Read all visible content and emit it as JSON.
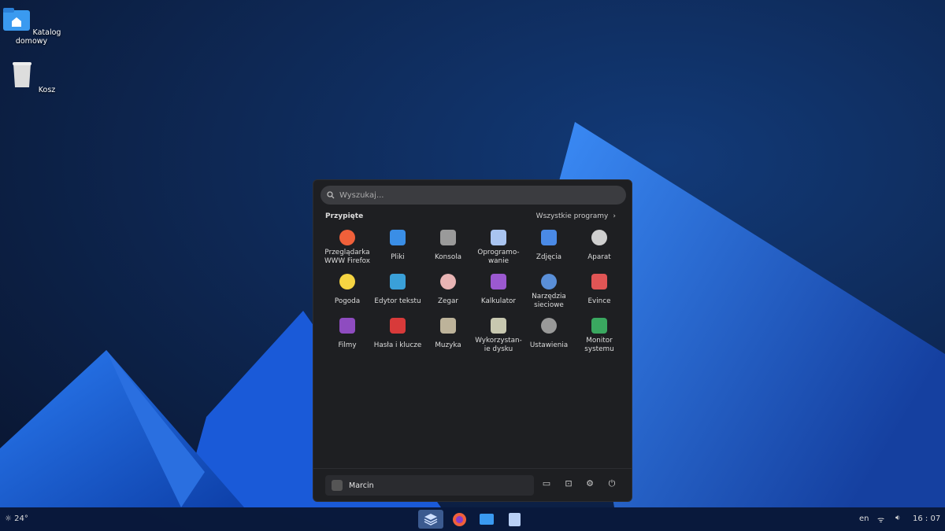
{
  "desktop": {
    "icons": [
      {
        "label": "Katalog domowy",
        "icon": "folder-home-icon"
      },
      {
        "label": "Kosz",
        "icon": "trash-icon"
      }
    ]
  },
  "menu": {
    "search_placeholder": "Wyszukaj...",
    "pinned_label": "Przypięte",
    "all_programs_label": "Wszystkie programy",
    "apps": [
      {
        "label": "Przeglądarka\nWWW Firefox",
        "icon": "firefox-icon",
        "color": "#f0603a"
      },
      {
        "label": "Pliki",
        "icon": "folder-icon",
        "color": "#3a8ee6"
      },
      {
        "label": "Konsola",
        "icon": "terminal-icon",
        "color": "#9a9a9a"
      },
      {
        "label": "Oprogramo-\nwanie",
        "icon": "software-icon",
        "color": "#a9c4f0"
      },
      {
        "label": "Zdjęcia",
        "icon": "photos-icon",
        "color": "#4a8ae6"
      },
      {
        "label": "Aparat",
        "icon": "camera-icon",
        "color": "#cfcfcf"
      },
      {
        "label": "Pogoda",
        "icon": "weather-icon",
        "color": "#f5d442"
      },
      {
        "label": "Edytor tekstu",
        "icon": "text-editor-icon",
        "color": "#3aa0d8"
      },
      {
        "label": "Zegar",
        "icon": "clock-icon",
        "color": "#e8b4b4"
      },
      {
        "label": "Kalkulator",
        "icon": "calculator-icon",
        "color": "#9b59d0"
      },
      {
        "label": "Narzędzia\nsieciowe",
        "icon": "network-tools-icon",
        "color": "#5a8fd8"
      },
      {
        "label": "Evince",
        "icon": "document-viewer-icon",
        "color": "#e05555"
      },
      {
        "label": "Filmy",
        "icon": "video-icon",
        "color": "#8e4cc0"
      },
      {
        "label": "Hasła i klucze",
        "icon": "passwords-icon",
        "color": "#d83a3a"
      },
      {
        "label": "Muzyka",
        "icon": "music-icon",
        "color": "#bdb39a"
      },
      {
        "label": "Wykorzystan-\nie dysku",
        "icon": "disk-usage-icon",
        "color": "#c8c8b0"
      },
      {
        "label": "Ustawienia",
        "icon": "settings-icon",
        "color": "#999999"
      },
      {
        "label": "Monitor\nsystemu",
        "icon": "system-monitor-icon",
        "color": "#3aa860"
      }
    ],
    "user_name": "Marcin"
  },
  "taskbar": {
    "weather": "24°",
    "language": "en",
    "clock": "16 : 07",
    "accent": "#3a6fd8"
  }
}
